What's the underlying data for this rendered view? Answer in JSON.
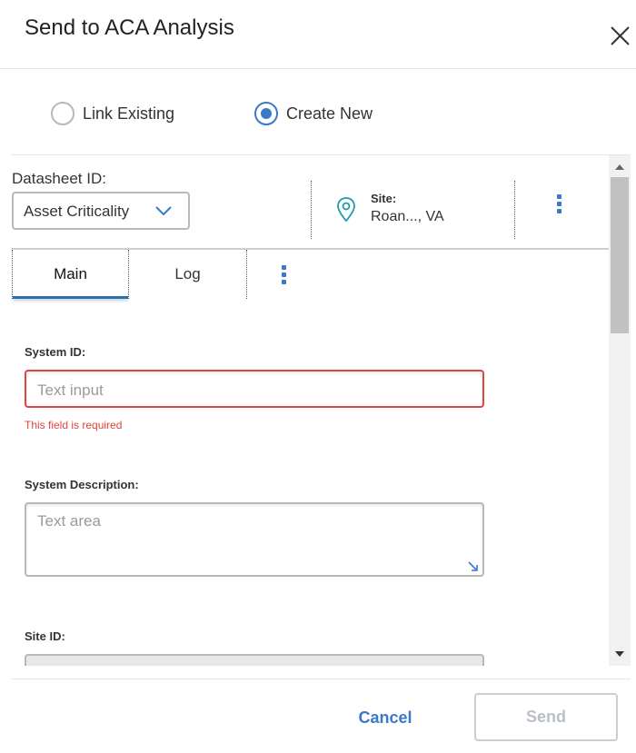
{
  "dialog": {
    "title": "Send to ACA Analysis"
  },
  "mode": {
    "options": [
      {
        "label": "Link Existing",
        "selected": false
      },
      {
        "label": "Create New",
        "selected": true
      }
    ]
  },
  "datasheet": {
    "label": "Datasheet ID:",
    "value": "Asset Criticality"
  },
  "site": {
    "label": "Site:",
    "value": "Roan..., VA"
  },
  "tabs": [
    {
      "label": "Main",
      "active": true
    },
    {
      "label": "Log",
      "active": false
    }
  ],
  "form": {
    "system_id": {
      "label": "System ID:",
      "placeholder": "Text input",
      "error": "This field is required"
    },
    "system_description": {
      "label": "System Description:",
      "placeholder": "Text area"
    },
    "site_id": {
      "label": "Site ID:"
    }
  },
  "footer": {
    "cancel_label": "Cancel",
    "send_label": "Send"
  },
  "colors": {
    "accent": "#3a78c9",
    "error": "#e0443a",
    "tab_underline": "#2f6fa3",
    "disabled_text": "#b9bfc8"
  }
}
